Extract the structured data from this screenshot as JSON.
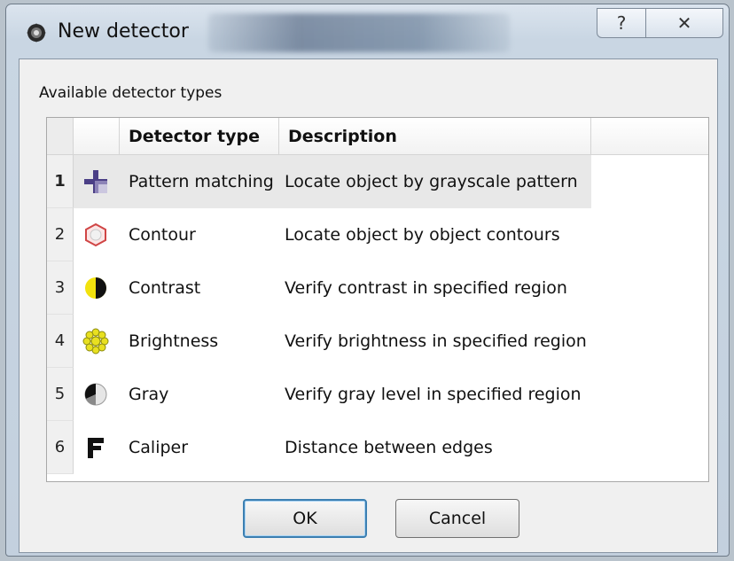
{
  "window": {
    "title": "New detector",
    "help_glyph": "?",
    "close_glyph": "✕"
  },
  "group": {
    "label": "Available detector types"
  },
  "table": {
    "columns": [
      "",
      "Detector type",
      "Description"
    ],
    "rows": [
      {
        "num": "1",
        "icon": "crosshair-icon",
        "type": "Pattern matching",
        "description": "Locate object by grayscale pattern",
        "selected": true
      },
      {
        "num": "2",
        "icon": "hexagon-icon",
        "type": "Contour",
        "description": "Locate object by object contours",
        "selected": false
      },
      {
        "num": "3",
        "icon": "half-circle-icon",
        "type": "Contrast",
        "description": "Verify contrast in specified region",
        "selected": false
      },
      {
        "num": "4",
        "icon": "sun-icon",
        "type": "Brightness",
        "description": "Verify brightness in specified region",
        "selected": false
      },
      {
        "num": "5",
        "icon": "gray-circle-icon",
        "type": "Gray",
        "description": "Verify gray level in specified region",
        "selected": false
      },
      {
        "num": "6",
        "icon": "caliper-icon",
        "type": "Caliper",
        "description": "Distance between edges",
        "selected": false
      }
    ]
  },
  "buttons": {
    "ok": "OK",
    "cancel": "Cancel"
  },
  "colors": {
    "accent": "#3c7fb1",
    "selected_row": "#e8e8e8"
  }
}
